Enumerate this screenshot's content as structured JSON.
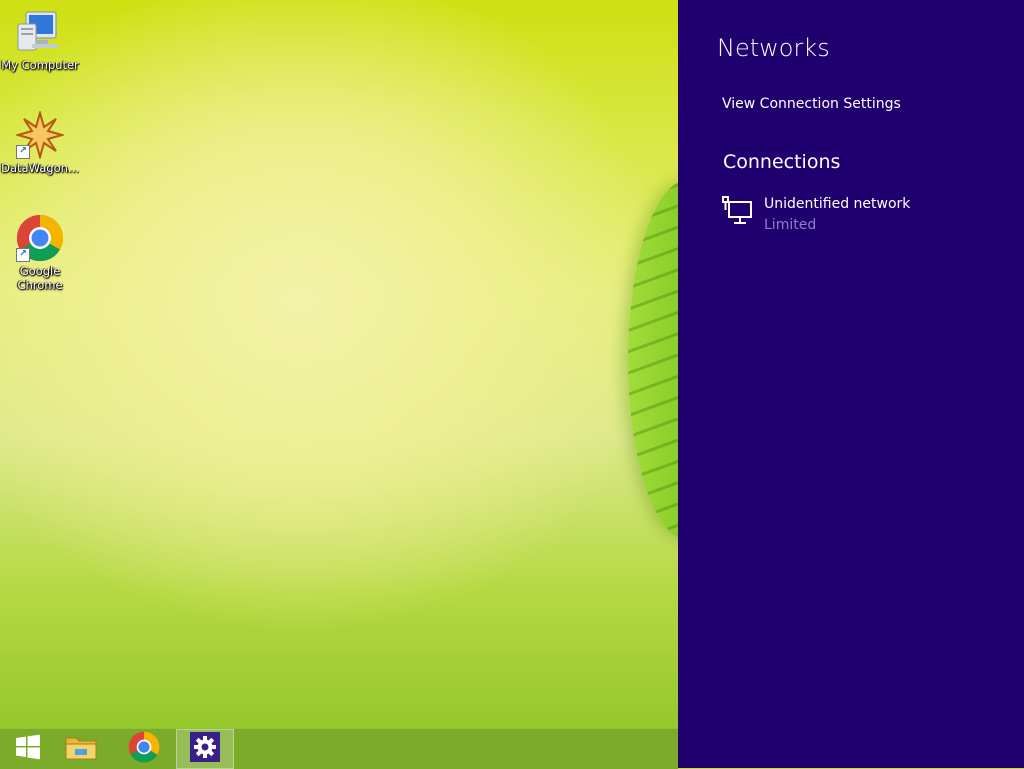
{
  "desktop": {
    "icons": [
      {
        "label": "My Computer",
        "icon": "computer-icon"
      },
      {
        "label": "DataWagon...",
        "icon": "datawagon-icon"
      },
      {
        "label": "Google Chrome",
        "icon": "chrome-icon"
      }
    ]
  },
  "taskbar": {
    "buttons": [
      {
        "icon": "windows-start-icon"
      },
      {
        "icon": "file-explorer-icon"
      },
      {
        "icon": "chrome-icon"
      },
      {
        "icon": "settings-gear-icon",
        "active": true
      }
    ]
  },
  "networks_panel": {
    "title": "Networks",
    "view_settings_link": "View Connection Settings",
    "connections_heading": "Connections",
    "connections": [
      {
        "name": "Unidentified network",
        "status": "Limited",
        "icon": "ethernet-icon"
      }
    ],
    "colors": {
      "background": "#20006e",
      "status_text": "#8d7fd0"
    }
  }
}
